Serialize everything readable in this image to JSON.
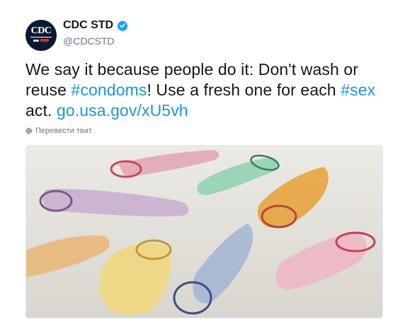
{
  "author": {
    "display_name": "CDC STD",
    "handle": "@CDCSTD",
    "verified": true,
    "avatar_text": "CDC"
  },
  "tweet": {
    "text_1": "We say it because people do it: Don't wash or reuse ",
    "hashtag_1": "#condoms",
    "text_2": "! Use a fresh one for each ",
    "hashtag_2": "#sex",
    "text_3": " act. ",
    "link": "go.usa.gov/xU5vh"
  },
  "translate_label": "Перевести твит",
  "colors": {
    "link": "#1b95e0",
    "text": "#14171a",
    "secondary": "#657786",
    "verified_badge": "#1da1f2"
  },
  "icons": {
    "verified": "verified-badge-icon",
    "translate": "globe-icon"
  }
}
